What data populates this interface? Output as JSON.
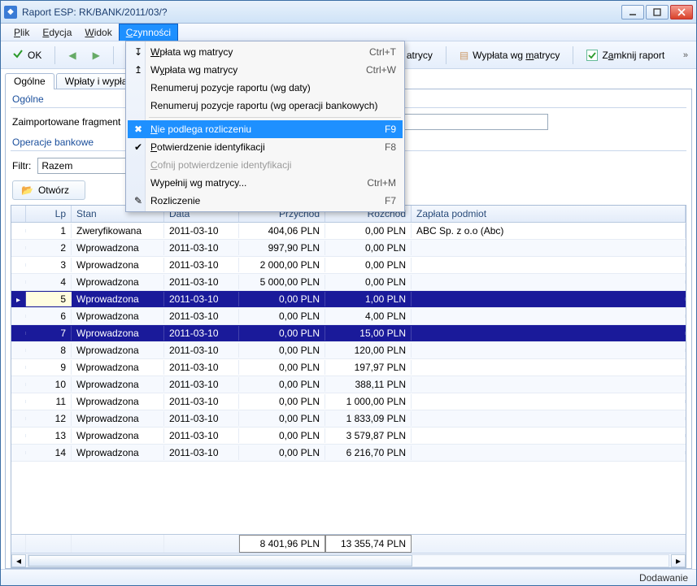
{
  "window": {
    "title": "Raport ESP: RK/BANK/2011/03/?"
  },
  "menubar": {
    "plik": "Plik",
    "edycja": "Edycja",
    "widok": "Widok",
    "czynnosci": "Czynności"
  },
  "menubar_u": {
    "plik": "P",
    "edycja": "E",
    "widok": "W",
    "czynnosci": "C"
  },
  "toolbar": {
    "ok": "OK",
    "matrycy_tail": "atrycy",
    "wyplata": "Wypłata wg matrycy",
    "wyplata_u": "m",
    "zamknij": "Zamknij raport",
    "zamknij_u": "a"
  },
  "tabs": {
    "ogolne": "Ogólne",
    "wplaty": "Wpłaty i wypłaty"
  },
  "sections": {
    "ogolne": "Ogólne",
    "zaimport": "Zaimportowane fragment",
    "operacje": "Operacje bankowe",
    "filtr": "Filtr:",
    "otworz": "Otwórz"
  },
  "filter": {
    "value": "Razem"
  },
  "dropdown": {
    "items": [
      {
        "label": "Wpłata wg matrycy",
        "u": "W",
        "shortcut": "Ctrl+T",
        "icon": "arrow-in"
      },
      {
        "label": "Wypłata wg matrycy",
        "u": "y",
        "shortcut": "Ctrl+W",
        "icon": "arrow-out"
      },
      {
        "label": "Renumeruj pozycje raportu (wg daty)",
        "icon": ""
      },
      {
        "label": "Renumeruj pozycje raportu (wg operacji bankowych)",
        "icon": ""
      },
      {
        "sep": true
      },
      {
        "label": "Nie podlega rozliczeniu",
        "u": "N",
        "shortcut": "F9",
        "hl": true,
        "icon": "cancel"
      },
      {
        "label": "Potwierdzenie identyfikacji",
        "u": "P",
        "shortcut": "F8",
        "icon": "check"
      },
      {
        "label": "Cofnij potwierdzenie identyfikacji",
        "u": "C",
        "disabled": true,
        "icon": ""
      },
      {
        "label": "Wypełnij wg matrycy...",
        "shortcut": "Ctrl+M",
        "icon": ""
      },
      {
        "label": "Rozliczenie",
        "shortcut": "F7",
        "icon": "tool"
      }
    ]
  },
  "grid": {
    "headers": {
      "lp": "Lp",
      "stan": "Stan",
      "data": "Data",
      "przychod": "Przychód",
      "rozchod": "Rozchód",
      "zaplata": "Zapłata podmiot"
    },
    "rows": [
      {
        "lp": "1",
        "stan": "Zweryfikowana",
        "data": "2011-03-10",
        "prz": "404,06 PLN",
        "roz": "0,00 PLN",
        "zap": "ABC Sp. z o.o (Abc)"
      },
      {
        "lp": "2",
        "stan": "Wprowadzona",
        "data": "2011-03-10",
        "prz": "997,90 PLN",
        "roz": "0,00 PLN",
        "zap": ""
      },
      {
        "lp": "3",
        "stan": "Wprowadzona",
        "data": "2011-03-10",
        "prz": "2 000,00 PLN",
        "roz": "0,00 PLN",
        "zap": ""
      },
      {
        "lp": "4",
        "stan": "Wprowadzona",
        "data": "2011-03-10",
        "prz": "5 000,00 PLN",
        "roz": "0,00 PLN",
        "zap": ""
      },
      {
        "lp": "5",
        "stan": "Wprowadzona",
        "data": "2011-03-10",
        "prz": "0,00 PLN",
        "roz": "1,00 PLN",
        "zap": "",
        "sel": true,
        "lead": true
      },
      {
        "lp": "6",
        "stan": "Wprowadzona",
        "data": "2011-03-10",
        "prz": "0,00 PLN",
        "roz": "4,00 PLN",
        "zap": ""
      },
      {
        "lp": "7",
        "stan": "Wprowadzona",
        "data": "2011-03-10",
        "prz": "0,00 PLN",
        "roz": "15,00 PLN",
        "zap": "",
        "sel": true
      },
      {
        "lp": "8",
        "stan": "Wprowadzona",
        "data": "2011-03-10",
        "prz": "0,00 PLN",
        "roz": "120,00 PLN",
        "zap": ""
      },
      {
        "lp": "9",
        "stan": "Wprowadzona",
        "data": "2011-03-10",
        "prz": "0,00 PLN",
        "roz": "197,97 PLN",
        "zap": ""
      },
      {
        "lp": "10",
        "stan": "Wprowadzona",
        "data": "2011-03-10",
        "prz": "0,00 PLN",
        "roz": "388,11 PLN",
        "zap": ""
      },
      {
        "lp": "11",
        "stan": "Wprowadzona",
        "data": "2011-03-10",
        "prz": "0,00 PLN",
        "roz": "1 000,00 PLN",
        "zap": ""
      },
      {
        "lp": "12",
        "stan": "Wprowadzona",
        "data": "2011-03-10",
        "prz": "0,00 PLN",
        "roz": "1 833,09 PLN",
        "zap": ""
      },
      {
        "lp": "13",
        "stan": "Wprowadzona",
        "data": "2011-03-10",
        "prz": "0,00 PLN",
        "roz": "3 579,87 PLN",
        "zap": ""
      },
      {
        "lp": "14",
        "stan": "Wprowadzona",
        "data": "2011-03-10",
        "prz": "0,00 PLN",
        "roz": "6 216,70 PLN",
        "zap": ""
      }
    ],
    "footer": {
      "prz": "8 401,96 PLN",
      "roz": "13 355,74 PLN"
    }
  },
  "status": {
    "text": "Dodawanie"
  },
  "colors": {
    "selection": "#1a1a9a",
    "menu_hl": "#1e90ff",
    "link": "#1b4f9c"
  }
}
